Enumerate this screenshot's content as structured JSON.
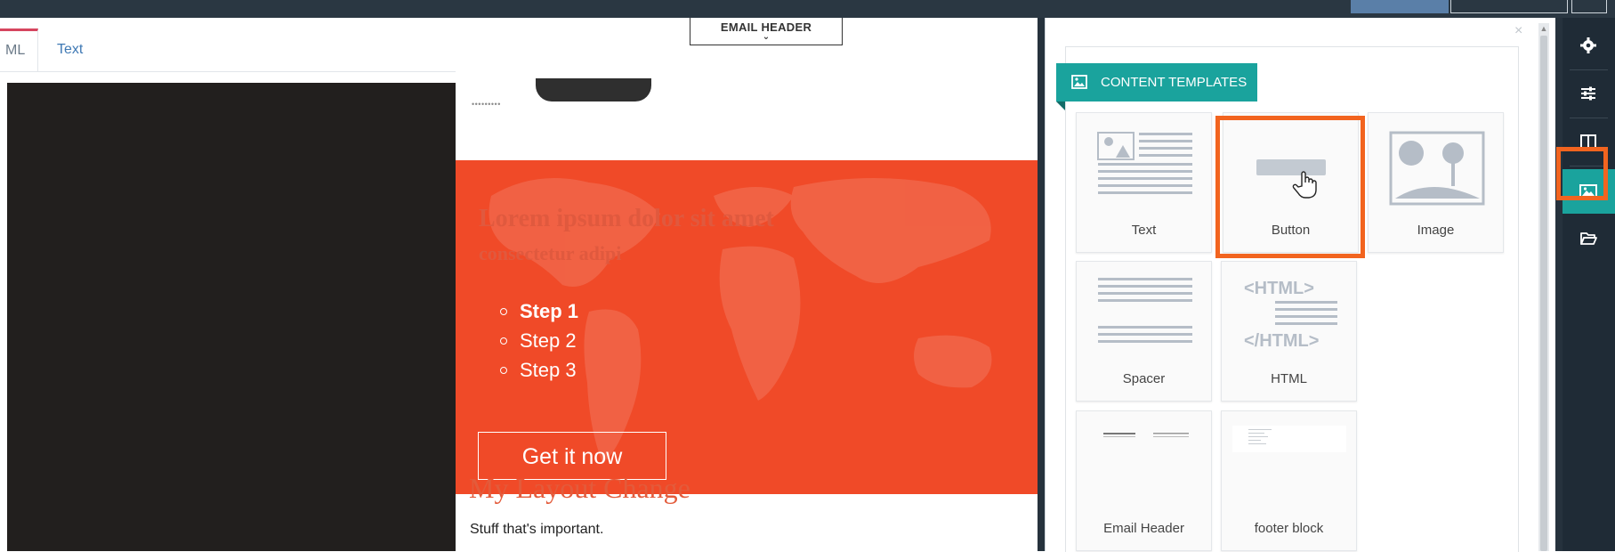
{
  "editor": {
    "tabs": [
      {
        "label": "ML",
        "active": true
      },
      {
        "label": "Text",
        "active": false
      }
    ],
    "email_header_pill": "EMAIL HEADER"
  },
  "email": {
    "logo_dots": "•••••••••",
    "hero": {
      "faded_title": "Lorem ipsum dolor sit amet",
      "faded_subtitle": "consectetur adipi",
      "steps": [
        "Step 1",
        "Step 2",
        "Step 3"
      ],
      "cta_label": "Get it now"
    },
    "section_heading": "My Layout Change",
    "section_body": "Stuff that's important."
  },
  "content_templates": {
    "title": "CONTENT TEMPLATES",
    "close_symbol": "×",
    "tiles": [
      {
        "label": "Text",
        "icon": "text-block-icon"
      },
      {
        "label": "Button",
        "icon": "button-block-icon",
        "highlighted": true
      },
      {
        "label": "Image",
        "icon": "image-block-icon"
      },
      {
        "label": "Spacer",
        "icon": "spacer-block-icon"
      },
      {
        "label": "HTML",
        "icon": "html-block-icon",
        "html_open": "<HTML>",
        "html_close": "</HTML>"
      },
      {
        "label": "Email Header",
        "icon": "email-header-thumbnail"
      },
      {
        "label": "footer block",
        "icon": "footer-block-thumbnail"
      }
    ]
  },
  "sidebar_icons": [
    {
      "name": "gear-icon",
      "active": false
    },
    {
      "name": "sliders-icon",
      "active": false
    },
    {
      "name": "columns-icon",
      "active": false
    },
    {
      "name": "image-icon",
      "active": true,
      "highlighted": true
    },
    {
      "name": "folder-open-icon",
      "active": false
    }
  ],
  "colors": {
    "accent_teal": "#1aa39d",
    "highlight_orange": "#f2641f",
    "hero_orange": "#f04a28",
    "heading_red": "#e35b3b",
    "dark_panel": "#1f2b36"
  }
}
